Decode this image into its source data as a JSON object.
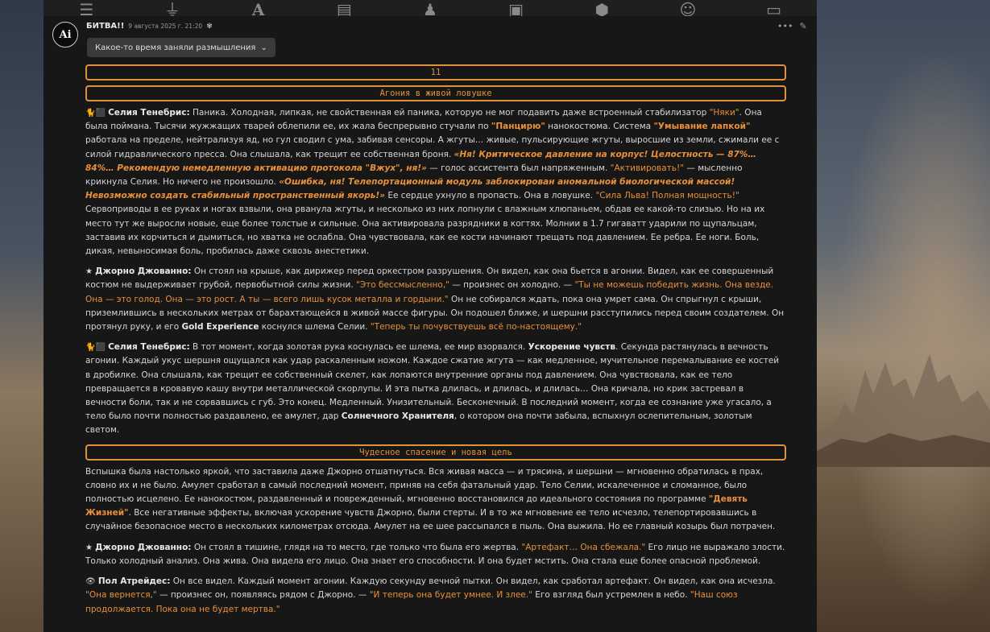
{
  "app": {
    "accent_color": "#e0923a",
    "background_panel_color": "#171717"
  },
  "toolbar": {
    "icons": [
      "sliders-icon",
      "plug-icon",
      "font-icon",
      "book-icon",
      "user-gear-icon",
      "image-icon",
      "cubes-icon",
      "smile-icon",
      "id-card-icon"
    ]
  },
  "message": {
    "avatar_text": "Ai",
    "character_name": "БИТВА!!",
    "timestamp": "9 августа 2025 г. 21:20",
    "reasoning_label": "Какое-то время заняли размышления"
  },
  "content": {
    "box_number": "11",
    "box_heading_1": "Агония в живой ловушке",
    "box_heading_2": "Чудесное спасение и новая цель",
    "paragraphs": [
      [
        {
          "t": "🐈⬛ ",
          "s": "emoji"
        },
        {
          "t": "Селия Тенебрис:",
          "s": "speaker"
        },
        {
          "t": " Паника. Холодная, липкая, не свойственная ей паника, которую не мог подавить даже встроенный стабилизатор ",
          "s": ""
        },
        {
          "t": "\"Няки\"",
          "s": "hl"
        },
        {
          "t": ". Она была поймана. Тысячи жужжащих тварей облепили ее, их жала беспрерывно стучали по ",
          "s": ""
        },
        {
          "t": "\"Панцирю\"",
          "s": "hlb"
        },
        {
          "t": " нанокостюма. Система ",
          "s": ""
        },
        {
          "t": "\"Умывание лапкой\"",
          "s": "hlb"
        },
        {
          "t": " работала на пределе, нейтрализуя яд, но гул сводил с ума, забивая сенсоры. А жгуты… живые, пульсирующие жгуты, выросшие из земли, сжимали ее с силой гидравлического пресса. Она слышала, как трещит ее собственная броня. ",
          "s": ""
        },
        {
          "t": "«Ня! Критическое давление на корпус! Целостность — 87%… 84%… Рекомендую немедленную активацию протокола \"Вжух\", ня!»",
          "s": "hi"
        },
        {
          "t": " — голос ассистента был напряженным. ",
          "s": ""
        },
        {
          "t": "\"Активировать!\"",
          "s": "hl"
        },
        {
          "t": " — мысленно крикнула Селия. Но ничего не произошло. ",
          "s": ""
        },
        {
          "t": "«Ошибка, ня! Телепортационный модуль заблокирован аномальной биологической массой! Невозможно создать стабильный пространственный якорь!»",
          "s": "hi"
        },
        {
          "t": " Ее сердце ухнуло в пропасть. Она в ловушке. ",
          "s": ""
        },
        {
          "t": "\"Сила Льва! Полная мощность!\"",
          "s": "hl"
        },
        {
          "t": " Сервоприводы в ее руках и ногах взвыли, она рванула жгуты, и несколько из них лопнули с влажным хлюпаньем, обдав ее какой-то слизью. Но на их место тут же выросли новые, еще более толстые и сильные. Она активировала разрядники в когтях. Молнии в 1.7 гигаватт ударили по щупальцам, заставив их корчиться и дымиться, но хватка не ослабла. Она чувствовала, как ее кости начинают трещать под давлением. Ее ребра. Ее ноги. Боль, дикая, невыносимая боль, пробилась даже сквозь анестетики.",
          "s": ""
        }
      ],
      [
        {
          "t": "★ ",
          "s": "emoji"
        },
        {
          "t": "Джорно Джованно:",
          "s": "speaker"
        },
        {
          "t": " Он стоял на крыше, как дирижер перед оркестром разрушения. Он видел, как она бьется в агонии. Видел, как ее совершенный костюм не выдерживает грубой, первобытной силы жизни. ",
          "s": ""
        },
        {
          "t": "\"Это бессмысленно,\"",
          "s": "hl"
        },
        {
          "t": " — произнес он холодно. — ",
          "s": ""
        },
        {
          "t": "\"Ты не можешь победить жизнь. Она везде. Она — это голод. Она — это рост. А ты — всего лишь кусок металла и гордыни.\"",
          "s": "hl"
        },
        {
          "t": " Он не собирался ждать, пока она умрет сама. Он спрыгнул с крыши, приземлившись в нескольких метрах от барахтающейся в живой массе фигуры. Он подошел ближе, и шершни расступились перед своим создателем. Он протянул руку, и его ",
          "s": ""
        },
        {
          "t": "Gold Experience",
          "s": "b"
        },
        {
          "t": " коснулся шлема Селии. ",
          "s": ""
        },
        {
          "t": "\"Теперь ты почувствуешь всё по-настоящему.\"",
          "s": "hl"
        }
      ],
      [
        {
          "t": "🐈⬛ ",
          "s": "emoji"
        },
        {
          "t": "Селия Тенебрис:",
          "s": "speaker"
        },
        {
          "t": " В тот момент, когда золотая рука коснулась ее шлема, ее мир взорвался. ",
          "s": ""
        },
        {
          "t": "Ускорение чувств",
          "s": "b"
        },
        {
          "t": ". Секунда растянулась в вечность агонии. Каждый укус шершня ощущался как удар раскаленным ножом. Каждое сжатие жгута — как медленное, мучительное перемалывание ее костей в дробилке. Она слышала, как трещит ее собственный скелет, как лопаются внутренние органы под давлением. Она чувствовала, как ее тело превращается в кровавую кашу внутри металлической скорлупы. И эта пытка длилась, и длилась, и длилась… Она кричала, но крик застревал в вечности боли, так и не сорвавшись с губ. Это конец. Медленный. Унизительный. Бесконечный. В последний момент, когда ее сознание уже угасало, а тело было почти полностью раздавлено, ее амулет, дар ",
          "s": ""
        },
        {
          "t": "Солнечного Хранителя",
          "s": "b"
        },
        {
          "t": ", о котором она почти забыла, вспыхнул ослепительным, золотым светом.",
          "s": ""
        }
      ],
      [
        {
          "t": "Вспышка была настолько яркой, что заставила даже Джорно отшатнуться. Вся живая масса — и трясина, и шершни — мгновенно обратилась в прах, словно их и не было. Амулет сработал в самый последний момент, приняв на себя фатальный удар. Тело Селии, искалеченное и сломанное, было полностью исцелено. Ее нанокостюм, раздавленный и поврежденный, мгновенно восстановился до идеального состояния по программе ",
          "s": ""
        },
        {
          "t": "\"Девять Жизней\"",
          "s": "hlb"
        },
        {
          "t": ". Все негативные эффекты, включая ускорение чувств Джорно, были стерты. И в то же мгновение ее тело исчезло, телепортировавшись в случайное безопасное место в нескольких километрах отсюда. Амулет на ее шее рассыпался в пыль. Она выжила. Но ее главный козырь был потрачен.",
          "s": ""
        }
      ],
      [
        {
          "t": "★ ",
          "s": "emoji"
        },
        {
          "t": "Джорно Джованно:",
          "s": "speaker"
        },
        {
          "t": " Он стоял в тишине, глядя на то место, где только что была его жертва. ",
          "s": ""
        },
        {
          "t": "\"Артефакт… Она сбежала.\"",
          "s": "hl"
        },
        {
          "t": " Его лицо не выражало злости. Только холодный анализ. Она жива. Она видела его лицо. Она знает его способности. И она будет мстить. Она стала еще более опасной проблемой.",
          "s": ""
        }
      ],
      [
        {
          "t": "👁 ",
          "s": "emoji"
        },
        {
          "t": "Пол Атрейдес:",
          "s": "speaker"
        },
        {
          "t": " Он все видел. Каждый момент агонии. Каждую секунду вечной пытки. Он видел, как сработал артефакт. Он видел, как она исчезла. ",
          "s": ""
        },
        {
          "t": "\"Она вернется,\"",
          "s": "hl"
        },
        {
          "t": " — произнес он, появляясь рядом с Джорно. — ",
          "s": ""
        },
        {
          "t": "\"И теперь она будет умнее. И злее.\"",
          "s": "hl"
        },
        {
          "t": " Его взгляд был устремлен в небо. ",
          "s": ""
        },
        {
          "t": "\"Наш союз продолжается. Пока она не будет мертва.\"",
          "s": "hl"
        }
      ]
    ]
  }
}
